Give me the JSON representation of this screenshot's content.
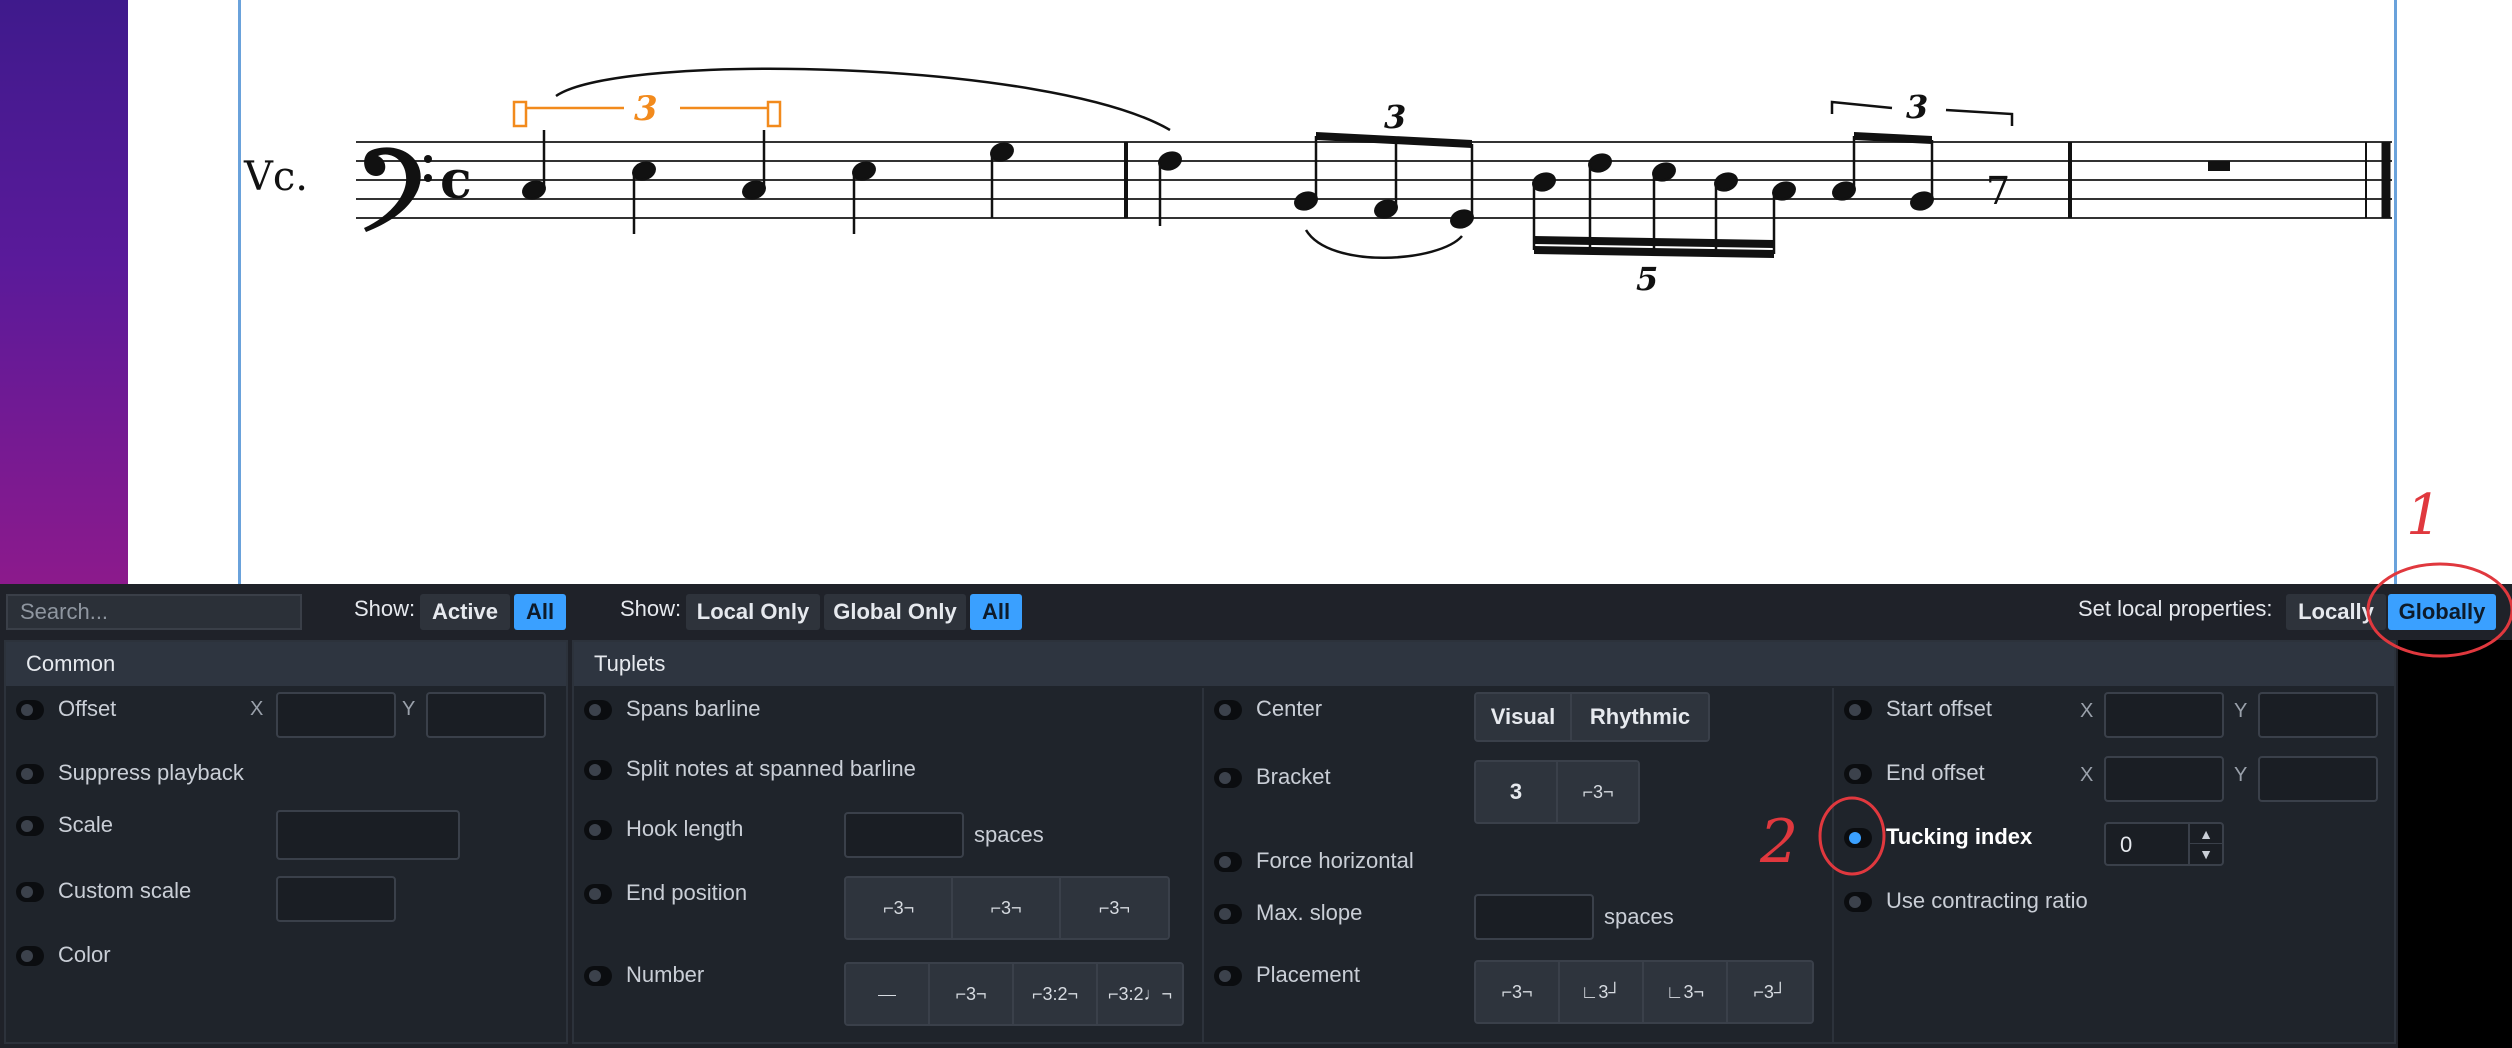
{
  "score": {
    "instrument_abbrev": "Vc.",
    "tuplet_numbers": [
      "3",
      "3",
      "5",
      "3"
    ]
  },
  "toolbar": {
    "search_placeholder": "Search...",
    "show1_label": "Show:",
    "show1_options": [
      "Active",
      "All"
    ],
    "show1_selected": "All",
    "show2_label": "Show:",
    "show2_options": [
      "Local Only",
      "Global Only",
      "All"
    ],
    "show2_selected": "All",
    "set_local_label": "Set local properties:",
    "set_local_options": [
      "Locally",
      "Globally"
    ],
    "set_local_selected": "Globally"
  },
  "common": {
    "title": "Common",
    "offset": "Offset",
    "x": "X",
    "y": "Y",
    "suppress_playback": "Suppress playback",
    "scale": "Scale",
    "custom_scale": "Custom scale",
    "color": "Color"
  },
  "tuplets": {
    "title": "Tuplets",
    "spans_barline": "Spans barline",
    "split_notes": "Split notes at spanned barline",
    "hook_length": "Hook length",
    "spaces": "spaces",
    "end_position": "End position",
    "number": "Number",
    "center": "Center",
    "center_options": [
      "Visual",
      "Rhythmic"
    ],
    "bracket": "Bracket",
    "bracket_options": [
      "3",
      "⌐3¬"
    ],
    "force_horizontal": "Force horizontal",
    "max_slope": "Max. slope",
    "placement": "Placement",
    "start_offset": "Start offset",
    "end_offset": "End offset",
    "tucking_index": "Tucking index",
    "tucking_value": "0",
    "use_contracting_ratio": "Use contracting ratio",
    "number_icons": [
      "⎯⎯",
      "⌐3¬",
      "⌐3:2¬",
      "⌐3:2♩¬"
    ],
    "placement_icons": [
      "⌐3¬",
      "∟3┘",
      "∟3¬",
      "⌐3┘"
    ],
    "end_position_icons": [
      "⌐3¬",
      "⌐3¬",
      "⌐3¬"
    ]
  },
  "annotations": {
    "one": "1",
    "two": "2",
    "color": "#e0383e"
  }
}
